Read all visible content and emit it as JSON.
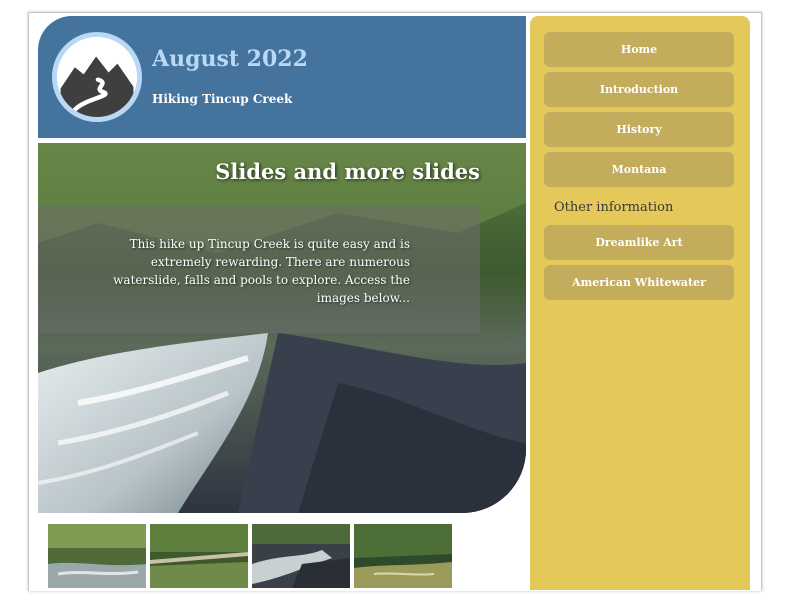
{
  "header": {
    "title": "August 2022",
    "subtitle": "Hiking Tincup Creek",
    "logo_icon": "mountain-river-logo-icon"
  },
  "hero": {
    "heading": "Slides and more slides",
    "text": "This hike up Tincup Creek is quite easy and is extremely rewarding. There are numerous waterslide, falls and pools to explore. Access the images below..."
  },
  "sidebar": {
    "nav_items": [
      {
        "label": "Home"
      },
      {
        "label": "Introduction"
      },
      {
        "label": "History"
      },
      {
        "label": "Montana"
      }
    ],
    "other_heading": "Other information",
    "other_items": [
      {
        "label": "Dreamlike Art"
      },
      {
        "label": "American Whitewater"
      }
    ]
  },
  "thumbnails": [
    {
      "icon": "creek-photo-thumbnail"
    },
    {
      "icon": "log-pool-photo-thumbnail"
    },
    {
      "icon": "waterslide-photo-thumbnail"
    },
    {
      "icon": "forest-creek-photo-thumbnail"
    }
  ],
  "colors": {
    "header_bg": "#44739e",
    "title_color": "#b8d8f5",
    "sidebar_bg": "#e4c85a",
    "nav_button_bg": "#c3ad5c"
  }
}
